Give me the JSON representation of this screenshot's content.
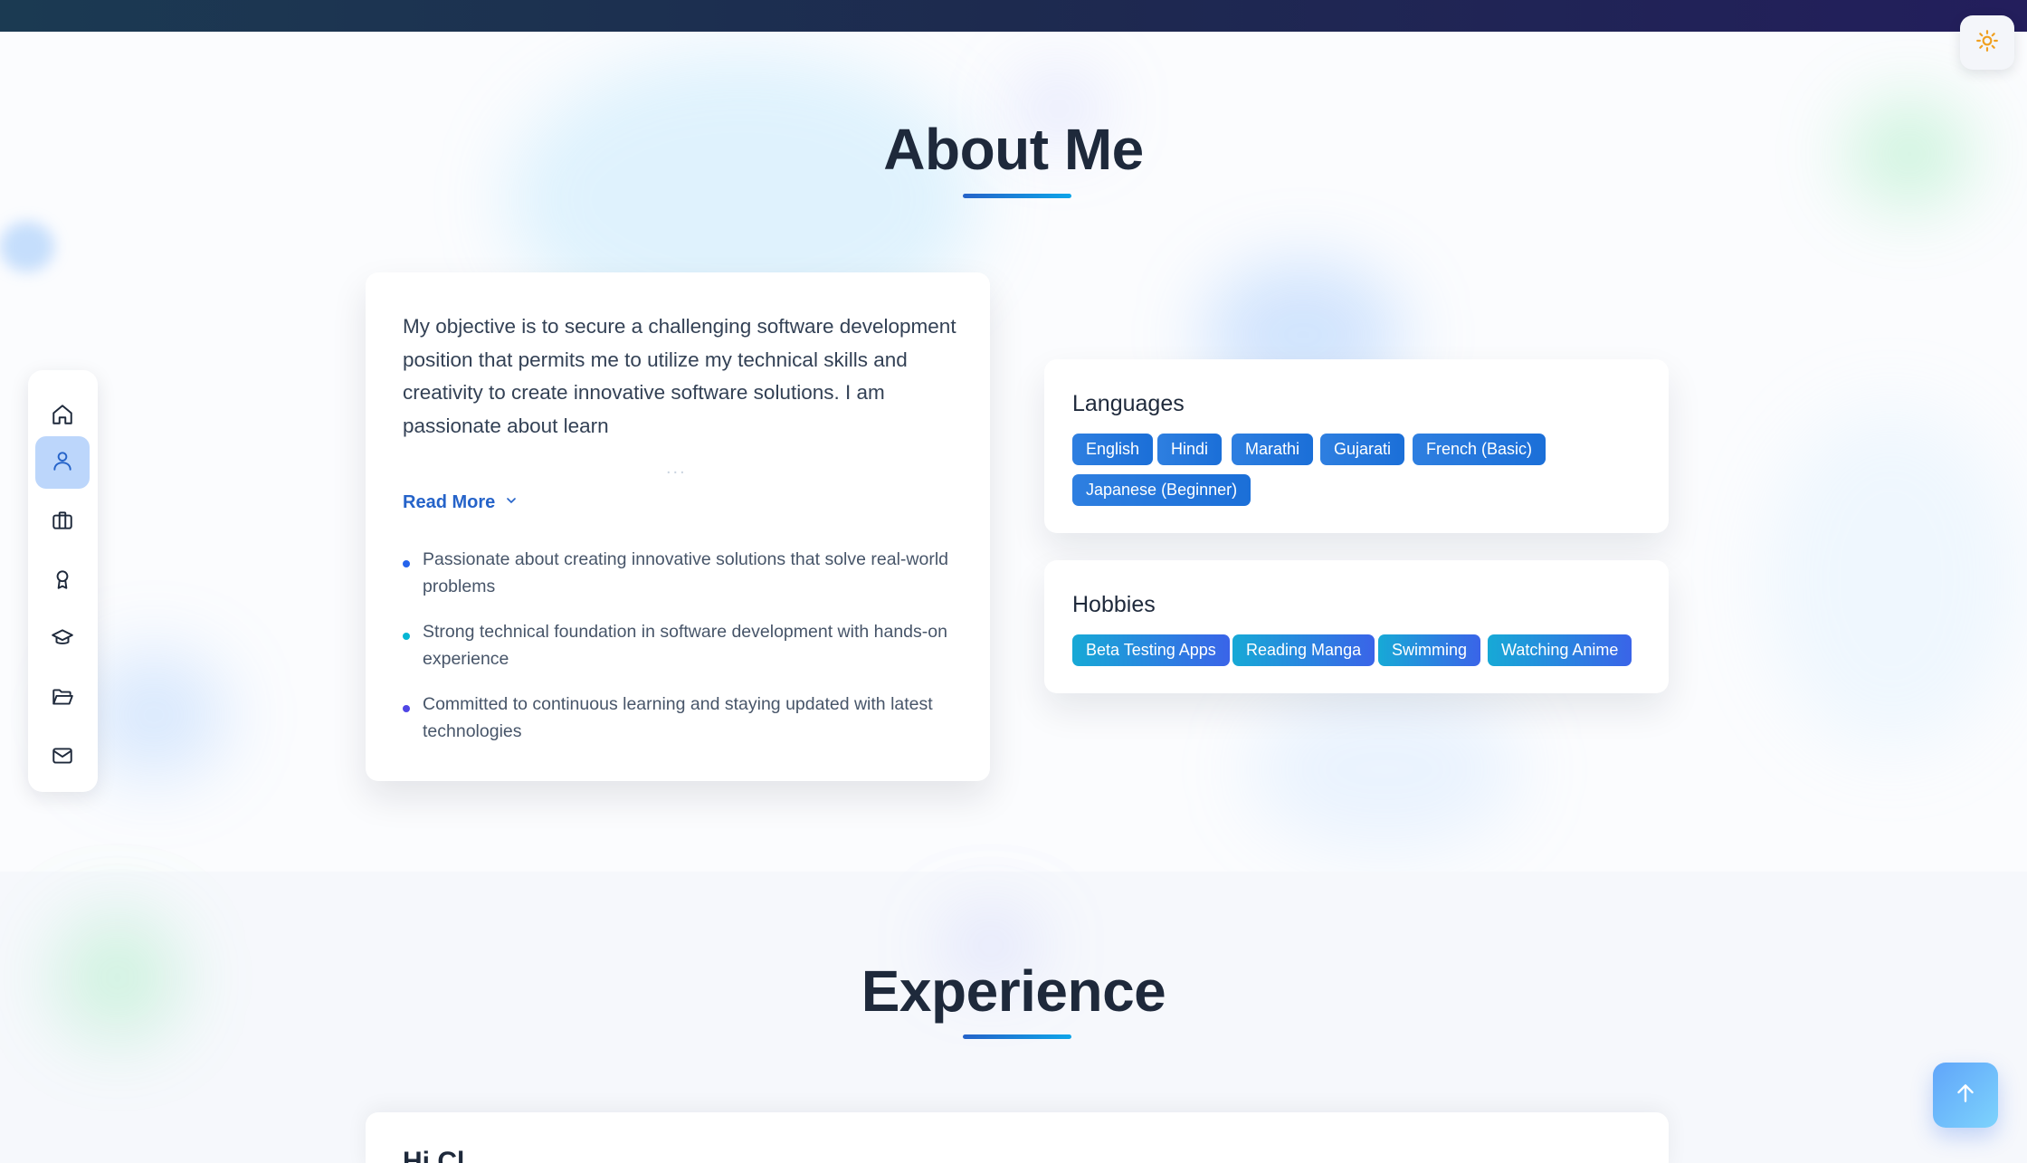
{
  "theme_toggle": {
    "icon": "sun-icon"
  },
  "side_nav": {
    "items": [
      {
        "id": "home",
        "icon": "home-icon",
        "active": false
      },
      {
        "id": "about",
        "icon": "user-icon",
        "active": true
      },
      {
        "id": "experience",
        "icon": "briefcase-icon",
        "active": false
      },
      {
        "id": "achievements",
        "icon": "award-icon",
        "active": false
      },
      {
        "id": "education",
        "icon": "graduation-cap-icon",
        "active": false
      },
      {
        "id": "projects",
        "icon": "folder-icon",
        "active": false
      },
      {
        "id": "contact",
        "icon": "mail-icon",
        "active": false
      }
    ]
  },
  "about": {
    "title": "About Me",
    "objective": "My objective is to secure a challenging software development position that permits me to utilize my technical skills and creativity to create innovative software solutions. I am passionate about learn",
    "fade_indicator": "...",
    "read_more_label": "Read More",
    "highlights": [
      {
        "text": "Passionate about creating innovative solutions that solve real-world problems",
        "color": "#2563eb"
      },
      {
        "text": "Strong technical foundation in software development with hands-on experience",
        "color": "#06b6d4"
      },
      {
        "text": "Committed to continuous learning and staying updated with latest technologies",
        "color": "#4f46e5"
      }
    ]
  },
  "languages": {
    "title": "Languages",
    "items": [
      "English",
      "Hindi",
      "Marathi",
      "Gujarati",
      "French (Basic)",
      "Japanese (Beginner)"
    ]
  },
  "hobbies": {
    "title": "Hobbies",
    "items": [
      "Beta Testing Apps",
      "Reading Manga",
      "Swimming",
      "Watching Anime"
    ]
  },
  "experience": {
    "title": "Experience",
    "first_card_title": "Hi Cl"
  },
  "scroll_top": {
    "icon": "arrow-up-icon"
  },
  "colors": {
    "accent": "#2563c9",
    "active_nav_bg": "#bcd6fb",
    "top_bar_start": "#1b3a52",
    "top_bar_end": "#231e5c"
  }
}
